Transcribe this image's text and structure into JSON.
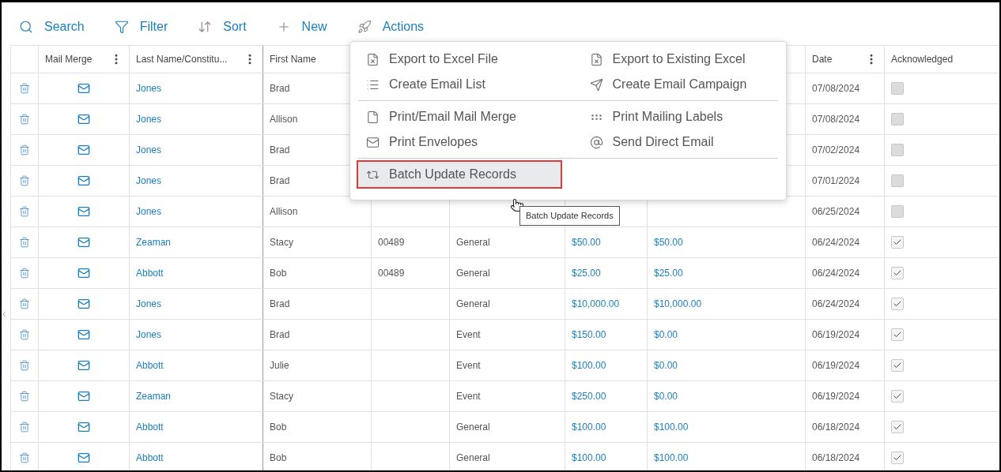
{
  "toolbar": [
    {
      "label": "Search"
    },
    {
      "label": "Filter"
    },
    {
      "label": "Sort"
    },
    {
      "label": "New"
    },
    {
      "label": "Actions"
    }
  ],
  "table": {
    "columns": [
      {},
      {
        "label": "Mail Merge",
        "menu": true
      },
      {
        "label": "Last Name/Constitu...",
        "menu": true
      },
      {
        "label": "First Name",
        "menu": false
      },
      {},
      {},
      {},
      {},
      {
        "label": "Date",
        "menu": true
      },
      {
        "label": "Acknowledged",
        "menu": false
      }
    ],
    "rows": [
      {
        "last_name": "Jones",
        "first_name": "Brad",
        "date": "07/08/2024",
        "acknowledged": false
      },
      {
        "last_name": "Jones",
        "first_name": "Allison",
        "date": "07/08/2024",
        "acknowledged": false
      },
      {
        "last_name": "Jones",
        "first_name": "Brad",
        "date": "07/02/2024",
        "acknowledged": false
      },
      {
        "last_name": "Jones",
        "first_name": "Brad",
        "date": "07/01/2024",
        "acknowledged": false
      },
      {
        "last_name": "Jones",
        "first_name": "Allison",
        "date": "06/25/2024",
        "acknowledged": false
      },
      {
        "last_name": "Zeaman",
        "first_name": "Stacy",
        "column_5": "00489",
        "column_6": "General",
        "column_7": "$50.00",
        "column_8": "$50.00",
        "date": "06/24/2024",
        "acknowledged": true
      },
      {
        "last_name": "Abbott",
        "first_name": "Bob",
        "column_5": "00489",
        "column_6": "General",
        "column_7": "$25.00",
        "column_8": "$25.00",
        "date": "06/24/2024",
        "acknowledged": true
      },
      {
        "last_name": "Jones",
        "first_name": "Brad",
        "column_6": "General",
        "column_7": "$10,000.00",
        "column_8": "$10,000.00",
        "date": "06/24/2024",
        "acknowledged": true
      },
      {
        "last_name": "Jones",
        "first_name": "Brad",
        "column_6": "Event",
        "column_7": "$150.00",
        "column_8": "$0.00",
        "date": "06/19/2024",
        "acknowledged": true
      },
      {
        "last_name": "Abbott",
        "first_name": "Julie",
        "column_6": "Event",
        "column_7": "$100.00",
        "column_8": "$0.00",
        "date": "06/19/2024",
        "acknowledged": true
      },
      {
        "last_name": "Zeaman",
        "first_name": "Stacy",
        "column_6": "Event",
        "column_7": "$250.00",
        "column_8": "$0.00",
        "date": "06/19/2024",
        "acknowledged": true
      },
      {
        "last_name": "Abbott",
        "first_name": "Bob",
        "column_6": "General",
        "column_7": "$100.00",
        "column_8": "$100.00",
        "date": "06/18/2024",
        "acknowledged": true
      },
      {
        "last_name": "Abbott",
        "first_name": "Bob",
        "column_6": "General",
        "column_7": "$100.00",
        "column_8": "$100.00",
        "date": "06/18/2024",
        "acknowledged": true
      }
    ]
  },
  "actions_menu": {
    "sections": [
      [
        {
          "label": "Export to Excel File",
          "selected": false
        },
        {
          "label": "Export to Existing Excel",
          "selected": false
        },
        {
          "label": "Create Email List",
          "selected": false
        },
        {
          "label": "Create Email Campaign",
          "selected": false
        }
      ],
      [
        {
          "label": "Print/Email Mail Merge",
          "selected": false
        },
        {
          "label": "Print Mailing Labels",
          "selected": false
        },
        {
          "label": "Print Envelopes",
          "selected": false
        },
        {
          "label": "Send Direct Email",
          "selected": false
        }
      ],
      [
        {
          "label": "Batch Update Records",
          "selected": true
        }
      ]
    ]
  },
  "tooltip": "Batch Update Records"
}
